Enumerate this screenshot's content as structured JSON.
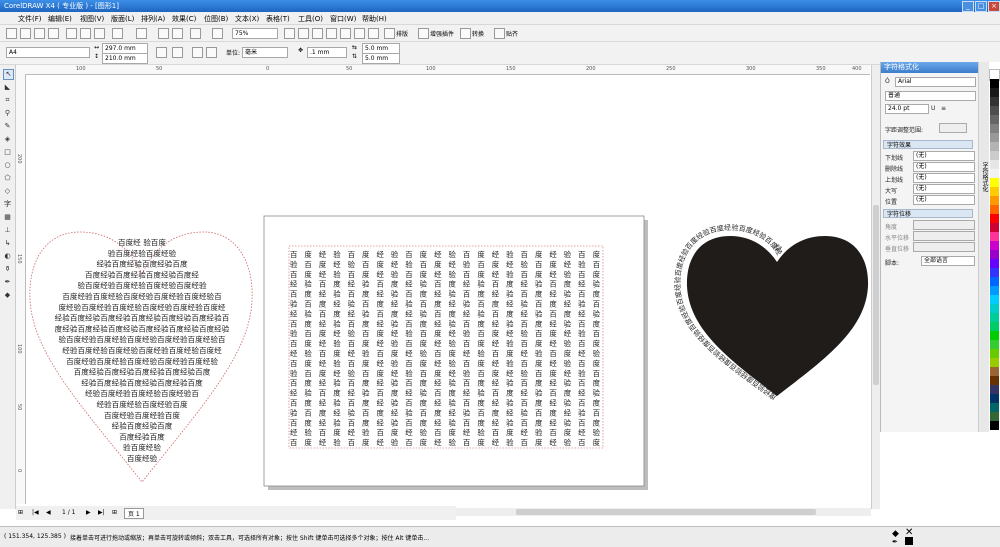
{
  "window": {
    "title": "CorelDRAW X4 ( 专业版 ) - [图形1]",
    "min_label": "_",
    "max_label": "□",
    "close_label": "×"
  },
  "menu": [
    "文件(F)",
    "编辑(E)",
    "视图(V)",
    "版面(L)",
    "排列(A)",
    "效果(C)",
    "位图(B)",
    "文本(X)",
    "表格(T)",
    "工具(O)",
    "窗口(W)",
    "帮助(H)"
  ],
  "standard_toolbar": {
    "zoom": "75%",
    "buttons": [
      "排版",
      "增强插件",
      "转换",
      "贴齐"
    ]
  },
  "property_bar": {
    "paper": "A4",
    "width": "297.0 mm",
    "height": "210.0 mm",
    "units_label": "单位:",
    "units": "毫米",
    "nudge": ".1 mm",
    "dup_x": "5.0 mm",
    "dup_y": "5.0 mm"
  },
  "docker": {
    "title": "字符格式化",
    "font": "Arial",
    "style": "普通",
    "size": "24.0 pt",
    "kerning_label": "字距调整范围:",
    "effects_title": "字符效果",
    "effects": [
      {
        "label": "下划线",
        "value": "(无)"
      },
      {
        "label": "删除线",
        "value": "(无)"
      },
      {
        "label": "上划线",
        "value": "(无)"
      },
      {
        "label": "大写",
        "value": "(无)"
      },
      {
        "label": "位置",
        "value": "(无)"
      }
    ],
    "shift_title": "字符位移",
    "shifts": [
      "角度",
      "水平位移",
      "垂直位移"
    ],
    "script_label": "脚本:",
    "script_value": "全部语言"
  },
  "dock_tabs": "字符格式化",
  "palette": [
    "#ffffff",
    "#000000",
    "#1a1a1a",
    "#333333",
    "#4d4d4d",
    "#666666",
    "#808080",
    "#999999",
    "#b3b3b3",
    "#cccccc",
    "#e6e6e6",
    "#f2f2f2",
    "#ffff00",
    "#ffcc00",
    "#ff9900",
    "#ff6600",
    "#ff0000",
    "#cc0033",
    "#ff3399",
    "#cc00cc",
    "#9900cc",
    "#6600ff",
    "#3333ff",
    "#0066ff",
    "#0099ff",
    "#00ccff",
    "#00cccc",
    "#00cc99",
    "#00cc66",
    "#00cc00",
    "#33cc33",
    "#66cc00",
    "#99cc00",
    "#996633",
    "#663300",
    "#333366",
    "#003366",
    "#006666",
    "#336633",
    "#000000"
  ],
  "rulers": {
    "top": [
      "100",
      "50",
      "0",
      "50",
      "100",
      "150",
      "200",
      "250",
      "300",
      "350",
      "400"
    ],
    "left": [
      "200",
      "150",
      "100",
      "50",
      "0"
    ]
  },
  "canvas": {
    "heart_left_lines": [
      "百度经         验百度",
      "验百度经验百度经验",
      "经验百度经验百度经验百度",
      "百度经验百度经验百度经验百度经",
      "验百度经验百度经验百度经验百度经验",
      "百度经验百度经验百度经验百度经验百度经验百",
      "度经验百度经验百度经验百度经验百度经验百度经",
      "经验百度经验百度经验百度经验百度经验百度经验百",
      "度经验百度经验百度经验百度经验百度经验百度经验",
      "验百度经验百度经验百度经验百度经验百度经验百",
      "经验百度经验百度经验百度经验百度经验百度经",
      "百度经验百度经验百度经验百度经验百度经验",
      "百度经验百度经验百度经验百度经验百度",
      "经验百度经验百度经验百度经验百度",
      "经验百度经验百度经验百度经验百",
      "经验百度经验百度经验百度",
      "百度经验百度经验百度",
      "经验百度经验百度",
      "百度经验百度",
      "验百度经验",
      "百度经验"
    ],
    "grid_lines": [
      "百 度 经 验 百 度 经 验 百 度 经 验 百 度 经 验 百 度 经 验 百 度",
      "验 百 度 经 验 百 度 经 验 百 度 经 验 百 度 经 验 百 度 经 验 百",
      "百 度 经 验 百 度 经 验 百 度 经 验 百 度 经 验 百 度 经 验 百 度",
      "经 验 百 度 经 验 百 度 经 验 百 度 经 验 百 度 经 验 百 度 经 验",
      "百 度 经 验 百 度 经 验 百 度 经 验 百 度 经 验 百 度 经 验 百 度",
      "验 百 度 经 验 百 度 经 验 百 度 经 验 百 度 经 验 百 度 经 验 百",
      "经 验 百 度 经 验 百 度 经 验 百 度 经 验 百 度 经 验 百 度 经 验",
      "百 度 经 验 百 度 经 验 百 度 经 验 百 度 经 验 百 度 经 验 百 度",
      "验 百 度 经 验 百 度 经 验 百 度 经 验 百 度 经 验 百 度 经 验 百",
      "百 度 经 验 百 度 经 验 百 度 经 验 百 度 经 验 百 度 经 验 百 度",
      "经 验 百 度 经 验 百 度 经 验 百 度 经 验 百 度 经 验 百 度 经 验",
      "百 度 经 验 百 度 经 验 百 度 经 验 百 度 经 验 百 度 经 验 百 度",
      "验 百 度 经 验 百 度 经 验 百 度 经 验 百 度 经 验 百 度 经 验 百",
      "百 度 经 验 百 度 经 验 百 度 经 验 百 度 经 验 百 度 经 验 百 度",
      "经 验 百 度 经 验 百 度 经 验 百 度 经 验 百 度 经 验 百 度 经 验",
      "百 度 经 验 百 度 经 验 百 度 经 验 百 度 经 验 百 度 经 验 百 度",
      "验 百 度 经 验 百 度 经 验 百 度 经 验 百 度 经 验 百 度 经 验 百",
      "百 度 经 验 百 度 经 验 百 度 经 验 百 度 经 验 百 度 经 验 百 度",
      "经 验 百 度 经 验 百 度 经 验 百 度 经 验 百 度 经 验 百 度 经 验",
      "百 度 经 验 百 度 经 验 百 度 经 验 百 度 经 验 百 度 经 验 百 度"
    ],
    "heart_path_text": "度经验百度经验百度经验百度经验百度经验百度经验百度经验百度经验百度经验百度经验百度经验"
  },
  "navigator": {
    "page_count": "1 / 1",
    "page_tab": "页 1"
  },
  "status": {
    "coords": "( 151.354, 125.385 )",
    "hint": "接着单击可进行拖动或缩放；再单击可旋转或倾斜；双击工具，可选择所有对象；按住 Shift 键单击可选择多个对象；按住 Alt 键单击..."
  }
}
